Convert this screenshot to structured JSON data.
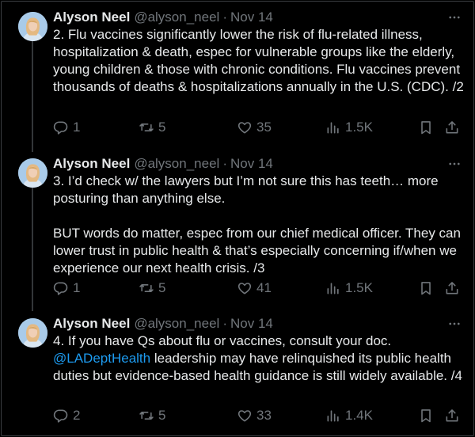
{
  "tweets": [
    {
      "name": "Alyson Neel",
      "handle": "@alyson_neel",
      "sep": "·",
      "date": "Nov 14",
      "text": "2. Flu vaccines significantly lower the risk of flu-related illness, hospitalization & death, espec for vulnerable groups like the elderly, young children & those with chronic conditions. Flu vaccines prevent thousands of deaths & hospitalizations annually in the U.S. (CDC). /2",
      "replies": "1",
      "reposts": "5",
      "likes": "35",
      "views": "1.5K"
    },
    {
      "name": "Alyson Neel",
      "handle": "@alyson_neel",
      "sep": "·",
      "date": "Nov 14",
      "text": "3. I’d check w/ the lawyers but I’m not sure this has teeth… more posturing than anything else.\n\nBUT words do matter, espec from our chief medical officer. They can lower trust in public health & that’s especially concerning if/when we experience our next health crisis. /3",
      "replies": "1",
      "reposts": "5",
      "likes": "41",
      "views": "1.5K"
    },
    {
      "name": "Alyson Neel",
      "handle": "@alyson_neel",
      "sep": "·",
      "date": "Nov 14",
      "text_before": "4. If you have Qs about flu or vaccines, consult your doc. ",
      "mention": "@LADeptHealth",
      "text_after": " leadership may have relinquished its public health duties but evidence-based health guidance is still widely available. /4",
      "replies": "2",
      "reposts": "5",
      "likes": "33",
      "views": "1.4K"
    }
  ],
  "icons": {
    "avatar": "avatar-photo",
    "more": "more-horizontal-icon",
    "reply": "reply-icon",
    "repost": "repost-icon",
    "like": "heart-icon",
    "views": "views-chart-icon",
    "bookmark": "bookmark-icon",
    "share": "share-icon"
  },
  "colors": {
    "background": "#000000",
    "text": "#e7e9ea",
    "muted": "#71767b",
    "link": "#1d9bf0",
    "thread_line": "#333639"
  }
}
